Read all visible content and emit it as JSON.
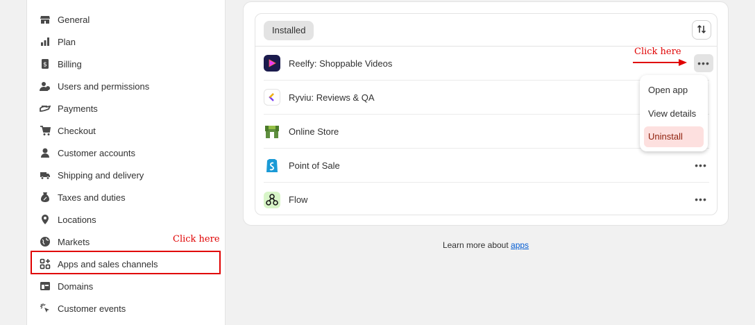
{
  "sidebar": {
    "items": [
      {
        "label": "General",
        "icon": "store-icon"
      },
      {
        "label": "Plan",
        "icon": "plan-icon"
      },
      {
        "label": "Billing",
        "icon": "billing-icon"
      },
      {
        "label": "Users and permissions",
        "icon": "users-icon"
      },
      {
        "label": "Payments",
        "icon": "payments-icon"
      },
      {
        "label": "Checkout",
        "icon": "cart-icon"
      },
      {
        "label": "Customer accounts",
        "icon": "person-icon"
      },
      {
        "label": "Shipping and delivery",
        "icon": "truck-icon"
      },
      {
        "label": "Taxes and duties",
        "icon": "tax-icon"
      },
      {
        "label": "Locations",
        "icon": "location-pin-icon"
      },
      {
        "label": "Markets",
        "icon": "globe-icon"
      },
      {
        "label": "Apps and sales channels",
        "icon": "apps-icon"
      },
      {
        "label": "Domains",
        "icon": "domains-icon"
      },
      {
        "label": "Customer events",
        "icon": "cursor-click-icon"
      }
    ]
  },
  "annotations": {
    "sidebar_hint": "Click here",
    "menu_hint": "Click here",
    "accent": "#e00000"
  },
  "apps_card": {
    "tab_label": "Installed",
    "apps": [
      {
        "name": "Reelfy: Shoppable Videos",
        "icon": "reelfy-icon",
        "color": "#1b1b4d"
      },
      {
        "name": "Ryviu: Reviews & QA",
        "icon": "ryviu-icon",
        "color": "#7b3ff2"
      },
      {
        "name": "Online Store",
        "icon": "online-store-icon",
        "color": "#5e8e3e"
      },
      {
        "name": "Point of Sale",
        "icon": "pos-icon",
        "color": "#1a9ad6"
      },
      {
        "name": "Flow",
        "icon": "flow-icon",
        "color": "#5bbf6b"
      }
    ],
    "more_label": "•••"
  },
  "popup_menu": {
    "items": [
      "Open app",
      "View details",
      "Uninstall"
    ]
  },
  "footer": {
    "text": "Learn more about",
    "link": "apps"
  }
}
